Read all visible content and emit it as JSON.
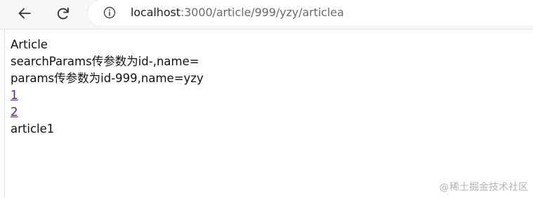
{
  "browser": {
    "url_host": "localhost",
    "url_path": ":3000/article/999/yzy/articlea"
  },
  "page": {
    "heading": "Article",
    "search_params_line": "searchParams传参数为id-,name=",
    "params_line": "params传参数为id-999,name=yzy",
    "links": [
      "1",
      "2"
    ],
    "footer_text": "article1"
  },
  "watermark": {
    "at_symbol": "@",
    "text": "稀土掘金技术社区"
  },
  "colors": {
    "link_visited": "#551a8b",
    "toolbar_bg": "#f7f7f7"
  },
  "icons": {
    "back": "back-arrow-icon",
    "reload": "reload-icon",
    "info": "info-icon"
  }
}
